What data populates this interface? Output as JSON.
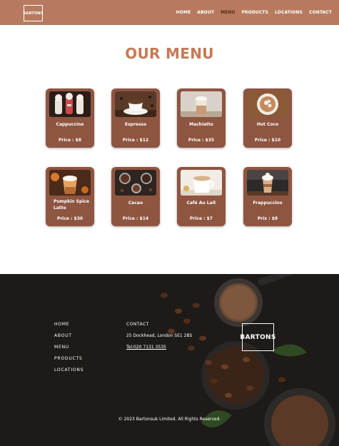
{
  "brand": {
    "logo_text": "BARTONS"
  },
  "nav": {
    "items": [
      {
        "label": "HOME"
      },
      {
        "label": "ABOUT"
      },
      {
        "label": "MENU",
        "active": true
      },
      {
        "label": "PRODUCTS"
      },
      {
        "label": "LOCATIONS"
      },
      {
        "label": "CONTACT"
      }
    ]
  },
  "menu": {
    "title": "OUR MENU",
    "items": [
      {
        "name": "Cappuccino",
        "price": "Price :  $8"
      },
      {
        "name": "Espresso",
        "price": "Price :  $12"
      },
      {
        "name": "Machiatto",
        "price": "Price :  $35"
      },
      {
        "name": "Hot Coco",
        "price": "Price :  $10"
      },
      {
        "name": "Pumpkin Spice Latte",
        "price": "Price :  $30"
      },
      {
        "name": "Cacao",
        "price": "Price :  $14"
      },
      {
        "name": "Café Au Lait",
        "price": "Price :  $7"
      },
      {
        "name": "Frappuccino",
        "price": "Prix :  $8"
      }
    ]
  },
  "footer": {
    "links": [
      "HOME",
      "ABOUT",
      "MENU",
      "PRODUCTS",
      "LOCATIONS"
    ],
    "contact": {
      "heading": "CONTACT",
      "address": "25 Dockhead, London SE1 2BS",
      "phone": "Tel:020 7131 3535"
    },
    "logo_text": "BARTONS",
    "copyright": "© 2023 Bartonsuk Limited. All Rights Reserved."
  },
  "colors": {
    "navbar": "#b77a5e",
    "active_nav": "#5a2a14",
    "title": "#c47a56",
    "card": "#8e5541",
    "footer": "#1e1a17"
  }
}
